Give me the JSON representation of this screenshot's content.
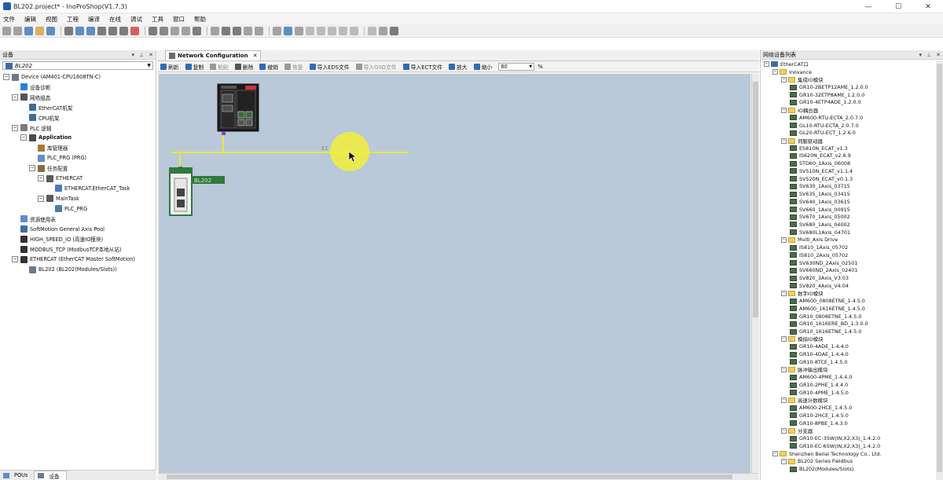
{
  "window": {
    "title": "BL202.project* - InoProShop(V1.7.3)"
  },
  "menu": [
    "文件",
    "编辑",
    "视图",
    "工程",
    "编译",
    "在线",
    "调试",
    "工具",
    "窗口",
    "帮助"
  ],
  "left_panel": {
    "title": "设备",
    "combo_value": "BL202",
    "tree": [
      {
        "label": "Device (AM401-CPU1608TN-C)",
        "level": 1,
        "expander": "−",
        "icon": "device-icon",
        "color": "#6b7b8c"
      },
      {
        "label": "设备诊断",
        "level": 2,
        "expander": "",
        "icon": "diagnostic-icon",
        "color": "#2a7fd4"
      },
      {
        "label": "网络组态",
        "level": 2,
        "expander": "−",
        "icon": "network-icon",
        "color": "#555555"
      },
      {
        "label": "EtherCAT机架",
        "level": 3,
        "expander": "",
        "icon": "rack-icon",
        "color": "#3c6e9f"
      },
      {
        "label": "CPU机架",
        "level": 3,
        "expander": "",
        "icon": "rack-icon",
        "color": "#3c6e9f"
      },
      {
        "label": "PLC 逻辑",
        "level": 2,
        "expander": "−",
        "icon": "plc-icon",
        "color": "#7b7b7b"
      },
      {
        "label": "Application",
        "level": 3,
        "expander": "−",
        "icon": "application-icon",
        "color": "#4a4a4a",
        "bold": true
      },
      {
        "label": "库管理器",
        "level": 4,
        "expander": "",
        "icon": "library-icon",
        "color": "#a97a2c"
      },
      {
        "label": "PLC_PRG (PRG)",
        "level": 4,
        "expander": "",
        "icon": "program-icon",
        "color": "#5d8fc9"
      },
      {
        "label": "任务配置",
        "level": 4,
        "expander": "−",
        "icon": "task-config-icon",
        "color": "#8a6d3b"
      },
      {
        "label": "ETHERCAT",
        "level": 5,
        "expander": "−",
        "icon": "task-icon",
        "color": "#5a5a5a"
      },
      {
        "label": "ETHERCAT.EtherCAT_Task",
        "level": 6,
        "expander": "",
        "icon": "task-call-icon",
        "color": "#4a7ab0"
      },
      {
        "label": "MainTask",
        "level": 5,
        "expander": "−",
        "icon": "task-icon",
        "color": "#5a5a5a"
      },
      {
        "label": "PLC_PRG",
        "level": 6,
        "expander": "",
        "icon": "task-call-icon",
        "color": "#4a7ab0"
      },
      {
        "label": "资源使用表",
        "level": 2,
        "expander": "",
        "icon": "resource-icon",
        "color": "#5d8fc9"
      },
      {
        "label": "SoftMotion General Axis Pool",
        "level": 2,
        "expander": "",
        "icon": "axis-pool-icon",
        "color": "#3a6ea5"
      },
      {
        "label": "HIGH_SPEED_IO (高速IO模块)",
        "level": 2,
        "expander": "",
        "icon": "io-module-icon",
        "color": "#333333"
      },
      {
        "label": "MODBUS_TCP (ModbusTCP本地从站)",
        "level": 2,
        "expander": "",
        "icon": "modbus-icon",
        "color": "#333333"
      },
      {
        "label": "ETHERCAT (EtherCAT Master SoftMotion)",
        "level": 2,
        "expander": "−",
        "icon": "ethercat-master-icon",
        "color": "#333333"
      },
      {
        "label": "BL202 (BL202(Modules/Slots))",
        "level": 3,
        "expander": "",
        "icon": "slave-icon",
        "color": "#6b7b8c"
      }
    ],
    "tabs": [
      "POUs",
      "设备"
    ]
  },
  "center": {
    "tab_label": "Network Configuration",
    "toolbar": [
      {
        "label": "刷新",
        "icon": "refresh-icon",
        "enabled": true,
        "color": "#2f6db5"
      },
      {
        "label": "复制",
        "icon": "copy-icon",
        "enabled": true,
        "color": "#2f6db5"
      },
      {
        "label": "粘贴",
        "icon": "paste-icon",
        "enabled": false,
        "color": "#9a9a9a"
      },
      {
        "label": "删除",
        "icon": "delete-icon",
        "enabled": true,
        "color": "#555555"
      },
      {
        "label": "撤销",
        "icon": "undo-icon",
        "enabled": true,
        "color": "#2f6db5"
      },
      {
        "label": "恢复",
        "icon": "redo-icon",
        "enabled": false,
        "color": "#9a9a9a"
      },
      {
        "label": "导入EDS文件",
        "icon": "import-eds-icon",
        "enabled": true,
        "color": "#2f6db5"
      },
      {
        "label": "导入GSD文件",
        "icon": "import-gsd-icon",
        "enabled": false,
        "color": "#9a9a9a"
      },
      {
        "label": "导入ECT文件",
        "icon": "import-ect-icon",
        "enabled": true,
        "color": "#2f6db5"
      },
      {
        "label": "放大",
        "icon": "zoom-in-icon",
        "enabled": true,
        "color": "#2f6db5"
      },
      {
        "label": "缩小",
        "icon": "zoom-out-icon",
        "enabled": true,
        "color": "#2f6db5"
      }
    ],
    "zoom_value": "80",
    "zoom_unit": "%",
    "canvas": {
      "bus_label": "E1",
      "slave_label": "BL202",
      "bus_color": "#e8e83a",
      "canvas_color": "#b9c9d9",
      "cursor_highlight": "#f2ef3a"
    }
  },
  "right_panel": {
    "title": "网络设备列表",
    "tree": [
      {
        "label": "EtherCAT口",
        "level": 0,
        "type": "root"
      },
      {
        "label": "Inovance",
        "level": 1,
        "type": "folder"
      },
      {
        "label": "集成IO模块",
        "level": 2,
        "type": "folder"
      },
      {
        "label": "GR10-2BETP12AME_1.2.0.0",
        "level": 3,
        "type": "item"
      },
      {
        "label": "GR10-32ETP8AME_1.2.0.0",
        "level": 3,
        "type": "item"
      },
      {
        "label": "GR10-4ETP4ADE_1.2.0.0",
        "level": 3,
        "type": "item"
      },
      {
        "label": "IO耦合器",
        "level": 2,
        "type": "folder"
      },
      {
        "label": "AM600-RTU-ECTA_2.0.7.0",
        "level": 3,
        "type": "item"
      },
      {
        "label": "GL10-RTU-ECTA_2.0.7.0",
        "level": 3,
        "type": "item"
      },
      {
        "label": "GL20-RTU-ECT_1.2.6.0",
        "level": 3,
        "type": "item"
      },
      {
        "label": "伺服驱动器",
        "level": 2,
        "type": "folder"
      },
      {
        "label": "ES810N_ECAT_v1.3",
        "level": 3,
        "type": "item"
      },
      {
        "label": "IS620N_ECAT_v2.6.9",
        "level": 3,
        "type": "item"
      },
      {
        "label": "STD60_1Axis_06008",
        "level": 3,
        "type": "item"
      },
      {
        "label": "SV510N_ECAT_v1.1.4",
        "level": 3,
        "type": "item"
      },
      {
        "label": "SV520N_ECAT_v0.1.3",
        "level": 3,
        "type": "item"
      },
      {
        "label": "SV630_1Axis_03715",
        "level": 3,
        "type": "item"
      },
      {
        "label": "SV635_1Axis_03415",
        "level": 3,
        "type": "item"
      },
      {
        "label": "SV640_1Axis_03615",
        "level": 3,
        "type": "item"
      },
      {
        "label": "SV660_1Axis_00915",
        "level": 3,
        "type": "item"
      },
      {
        "label": "SV670_1Axis_05002",
        "level": 3,
        "type": "item"
      },
      {
        "label": "SV680_1Axis_04002",
        "level": 3,
        "type": "item"
      },
      {
        "label": "SV680L1Axis_04701",
        "level": 3,
        "type": "item"
      },
      {
        "label": "Multi_Axis Drive",
        "level": 2,
        "type": "folder"
      },
      {
        "label": "IS810_1Axis_05702",
        "level": 3,
        "type": "item"
      },
      {
        "label": "IS810_2Axis_05702",
        "level": 3,
        "type": "item"
      },
      {
        "label": "SV630ND_2Axis_02501",
        "level": 3,
        "type": "item"
      },
      {
        "label": "SV660ND_2Axis_02401",
        "level": 3,
        "type": "item"
      },
      {
        "label": "SV820_3Axis_V3.03",
        "level": 3,
        "type": "item"
      },
      {
        "label": "SV820_4Axis_V4.04",
        "level": 3,
        "type": "item"
      },
      {
        "label": "数字IO模块",
        "level": 2,
        "type": "folder"
      },
      {
        "label": "AM600_0808ETNE_1.4.5.0",
        "level": 3,
        "type": "item"
      },
      {
        "label": "AM600_1616ETNE_1.4.5.0",
        "level": 3,
        "type": "item"
      },
      {
        "label": "GR10_0808ETNE_1.4.5.0",
        "level": 3,
        "type": "item"
      },
      {
        "label": "GR10_1616ERE_BD_1.3.0.0",
        "level": 3,
        "type": "item"
      },
      {
        "label": "GR10_1616ETNE_1.4.5.0",
        "level": 3,
        "type": "item"
      },
      {
        "label": "模拟IO模块",
        "level": 2,
        "type": "folder"
      },
      {
        "label": "GR10-4ADE_1.4.4.0",
        "level": 3,
        "type": "item"
      },
      {
        "label": "GR10-4DAE_1.4.4.0",
        "level": 3,
        "type": "item"
      },
      {
        "label": "GR10-8TCE_1.4.5.0",
        "level": 3,
        "type": "item"
      },
      {
        "label": "脉冲输出模块",
        "level": 2,
        "type": "folder"
      },
      {
        "label": "AM600-4PME_1.4.4.0",
        "level": 3,
        "type": "item"
      },
      {
        "label": "GR10-2PHE_1.4.4.0",
        "level": 3,
        "type": "item"
      },
      {
        "label": "GR10-4PME_1.4.5.0",
        "level": 3,
        "type": "item"
      },
      {
        "label": "高速计数模块",
        "level": 2,
        "type": "folder"
      },
      {
        "label": "AM600-2HCE_1.4.5.0",
        "level": 3,
        "type": "item"
      },
      {
        "label": "GR10-2HCE_1.4.5.0",
        "level": 3,
        "type": "item"
      },
      {
        "label": "GR10-8PBE_1.4.3.0",
        "level": 3,
        "type": "item"
      },
      {
        "label": "分支器",
        "level": 2,
        "type": "folder"
      },
      {
        "label": "GR10-EC-3SW(IN,X2,X3)_1.4.2.0",
        "level": 3,
        "type": "item"
      },
      {
        "label": "GR10-EC-6SW(IN,X2,X3)_1.4.2.0",
        "level": 3,
        "type": "item"
      },
      {
        "label": "Shenzhen Beilai Technology Co., Ltd.",
        "level": 1,
        "type": "folder"
      },
      {
        "label": "BL202 Series Fieldbus",
        "level": 2,
        "type": "folder"
      },
      {
        "label": "BL202(Modules/Slots)",
        "level": 3,
        "type": "item"
      }
    ]
  }
}
